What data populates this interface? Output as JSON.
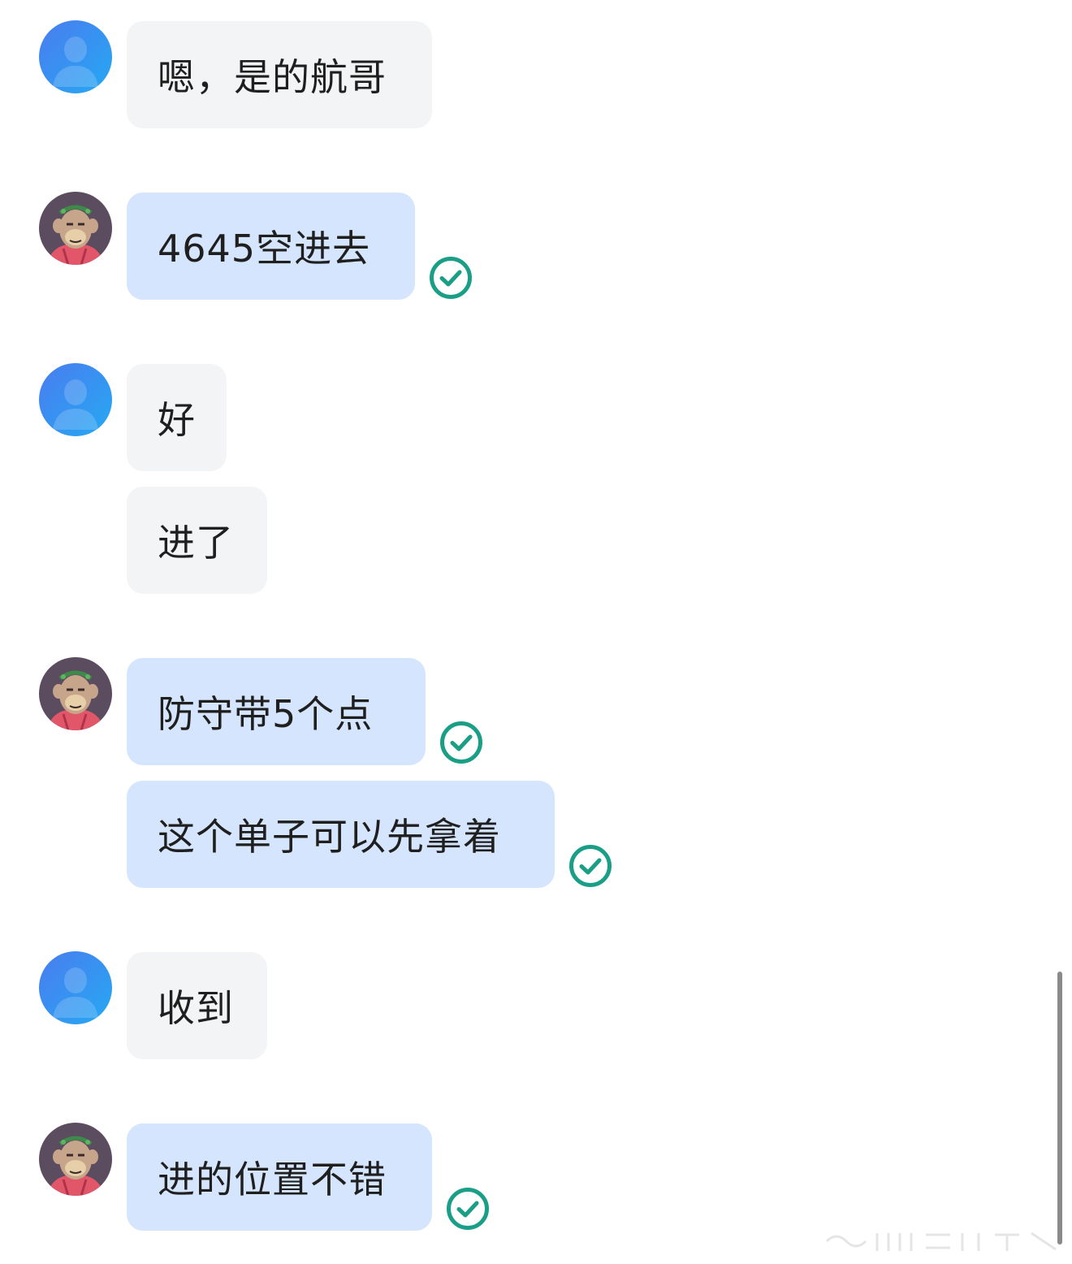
{
  "colors": {
    "incoming_bubble": "#f3f4f6",
    "outgoing_bubble": "#d5e5fd",
    "read_check": "#1a9f86",
    "default_avatar_gradient": [
      "#4a7cf0",
      "#25a9f2"
    ]
  },
  "messages": [
    {
      "sender": "other",
      "avatar": "default-person-icon",
      "text": "嗯，是的航哥"
    },
    {
      "sender": "self",
      "avatar": "ape-avatar",
      "text": "4645空进去",
      "status": "read-check-icon"
    },
    {
      "sender": "other",
      "avatar": "default-person-icon",
      "text": "好"
    },
    {
      "sender": "other",
      "text": "进了"
    },
    {
      "sender": "self",
      "avatar": "ape-avatar",
      "text": "防守带5个点",
      "status": "read-check-icon"
    },
    {
      "sender": "self",
      "text": "这个单子可以先拿着",
      "status": "read-check-icon"
    },
    {
      "sender": "other",
      "avatar": "default-person-icon",
      "text": "收到"
    },
    {
      "sender": "self",
      "avatar": "ape-avatar",
      "text": "进的位置不错",
      "status": "read-check-icon"
    }
  ]
}
